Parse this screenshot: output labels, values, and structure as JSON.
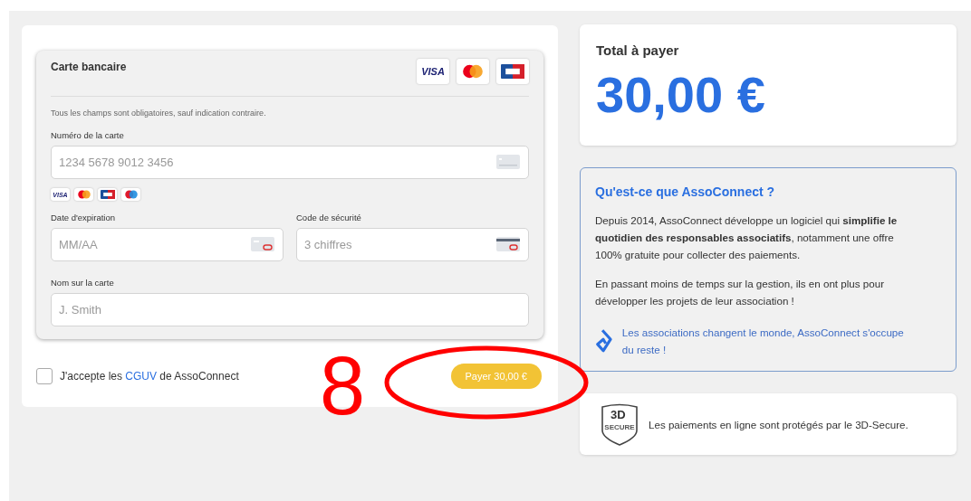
{
  "payment_form": {
    "card_title": "Carte bancaire",
    "card_brands": [
      {
        "kind": "visa",
        "label": "VISA"
      },
      {
        "kind": "mastercard"
      },
      {
        "kind": "cb"
      }
    ],
    "required_note": "Tous les champs sont obligatoires, sauf indication contraire.",
    "card_number": {
      "label": "Numéro de la carte",
      "placeholder": "1234 5678 9012 3456"
    },
    "accepted_brands": [
      {
        "kind": "visa",
        "label": "VISA"
      },
      {
        "kind": "mastercard"
      },
      {
        "kind": "cb"
      },
      {
        "kind": "maestro"
      }
    ],
    "expiry": {
      "label": "Date d'expiration",
      "placeholder": "MM/AA"
    },
    "security_code": {
      "label": "Code de sécurité",
      "placeholder": "3 chiffres"
    },
    "name_on_card": {
      "label": "Nom sur la carte",
      "placeholder": "J. Smith"
    },
    "terms": {
      "checked": false,
      "text_before": "J'accepte les",
      "link": "CGUV",
      "text_after": "de AssoConnect"
    },
    "pay_button": "Payer 30,00 €"
  },
  "total": {
    "label": "Total à payer",
    "amount": "30,00 €"
  },
  "about": {
    "title": "Qu'est-ce que AssoConnect ?",
    "paragraphs": [
      "Depuis 2014, AssoConnect développe un logiciel qui **simplifie le quotidien des responsables associatifs**, notamment une offre 100% gratuite pour collecter des paiements.",
      "En passant moins de temps sur la gestion, ils en ont plus pour développer les projets de leur association !"
    ],
    "slogan": "Les associations changent le monde, AssoConnect s'occupe du reste !"
  },
  "secure": {
    "badge_top": "3D",
    "badge_bottom": "SECURE",
    "text": "Les paiements en ligne sont protégés par le 3D-Secure."
  },
  "annotation": {
    "number": "8"
  }
}
